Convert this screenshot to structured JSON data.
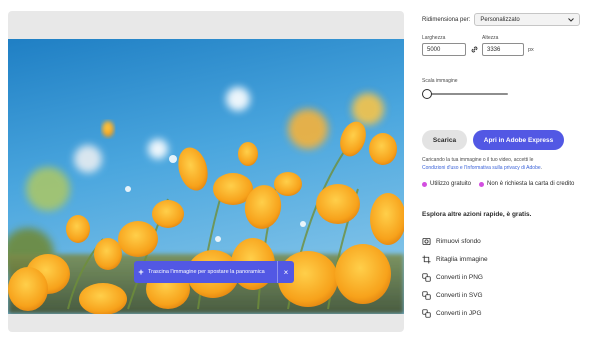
{
  "canvas": {
    "pan_message": "Trascina l'immagine per spostare la panoramica",
    "plus_glyph": "+",
    "close_glyph": "×"
  },
  "panel": {
    "resize_label": "Ridimensiona per:",
    "resize_value": "Personalizzato",
    "width_label": "Larghezza",
    "height_label": "Altezza",
    "width_value": "5000",
    "height_value": "3336",
    "unit": "px",
    "scale_label": "Scala immagine",
    "scale_level": 0,
    "download_label": "Scarica",
    "express_label": "Apri in Adobe Express",
    "terms_prefix": "Caricando la tua immagine o il tuo video, accetti le",
    "terms_link": "Condizioni d'uso e l'Informativa sulla privacy di Adobe",
    "terms_suffix": ".",
    "badge_free": "Utilizzo gratuito",
    "badge_no_card": "Non è richiesta la carta di credito",
    "badge_color": "#d34fe0",
    "quick_title": "Esplora altre azioni rapide, è gratis.",
    "quick_actions": [
      {
        "label": "Rimuovi sfondo",
        "icon": "remove-background-icon"
      },
      {
        "label": "Ritaglia immagine",
        "icon": "crop-icon"
      },
      {
        "label": "Converti in PNG",
        "icon": "convert-icon"
      },
      {
        "label": "Converti in SVG",
        "icon": "convert-icon"
      },
      {
        "label": "Converti in JPG",
        "icon": "convert-icon"
      }
    ],
    "accent_color": "#5258e4"
  }
}
